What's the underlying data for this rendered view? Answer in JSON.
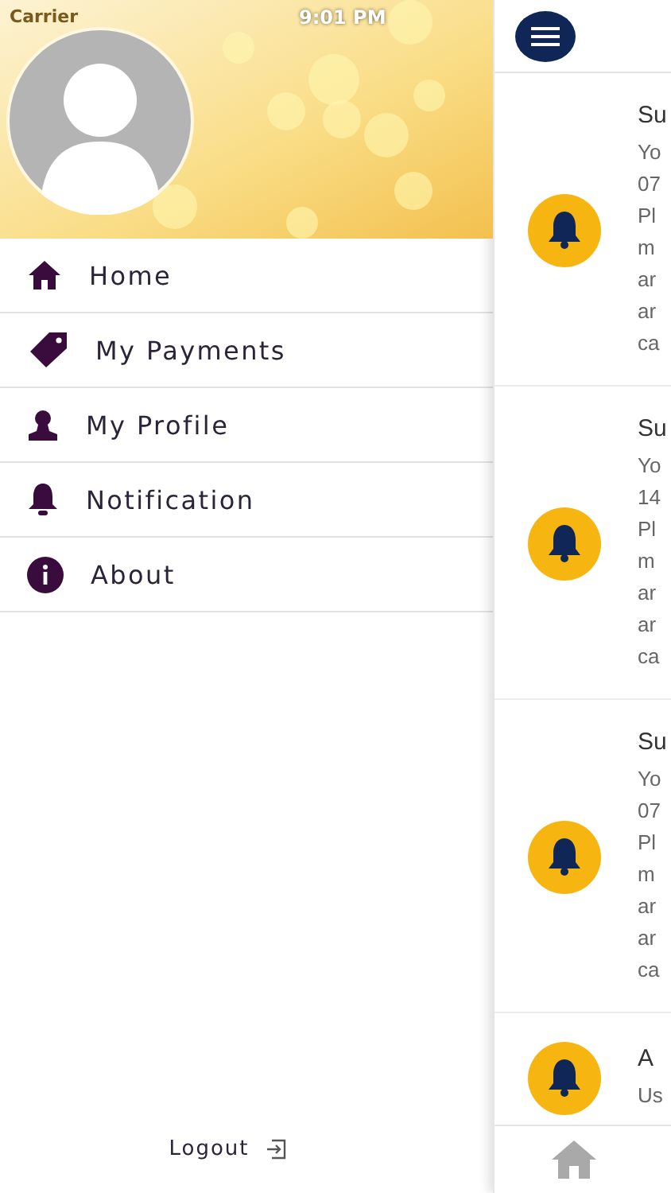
{
  "status_bar": {
    "carrier": "Carrier",
    "time": "9:01 PM"
  },
  "drawer": {
    "menu": [
      {
        "label": "Home"
      },
      {
        "label": "My Payments"
      },
      {
        "label": "My Profile"
      },
      {
        "label": "Notification"
      },
      {
        "label": "About"
      }
    ],
    "logout": "Logout"
  },
  "notifications": [
    {
      "title": "Su",
      "lines": [
        "Yo",
        "07",
        "Pl",
        "m",
        "ar",
        "ar",
        "ca"
      ]
    },
    {
      "title": "Su",
      "lines": [
        "Yo",
        "14",
        "Pl",
        "m",
        "ar",
        "ar",
        "ca"
      ]
    },
    {
      "title": "Su",
      "lines": [
        "Yo",
        "07",
        "Pl",
        "m",
        "ar",
        "ar",
        "ca"
      ]
    },
    {
      "title": "A",
      "lines": [
        "Us"
      ]
    }
  ]
}
